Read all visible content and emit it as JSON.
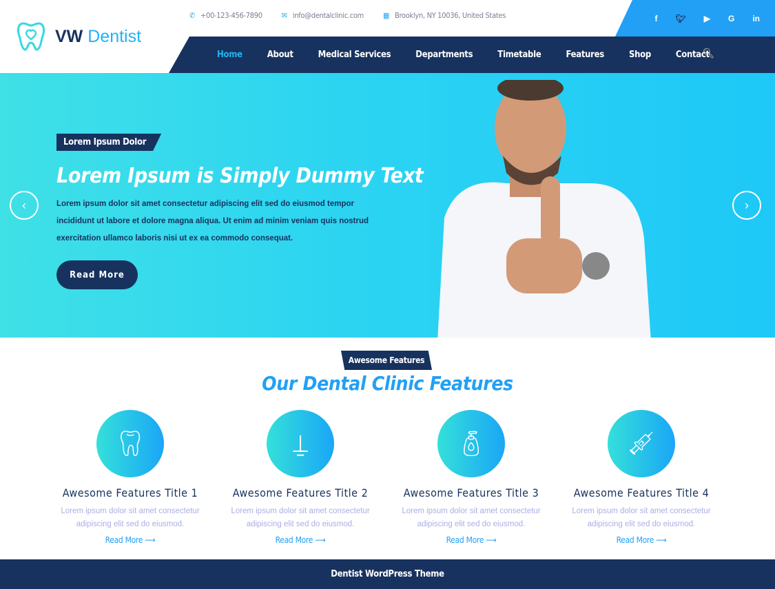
{
  "brand": {
    "name_bold": "VW",
    "name": "Dentist"
  },
  "topbar": {
    "phone": "+00-123-456-7890",
    "email": "info@dentalclinic.com",
    "address": "Brooklyn, NY 10036, United States"
  },
  "social": [
    "f",
    "t",
    "yt",
    "G",
    "in"
  ],
  "nav": [
    "Home",
    "About",
    "Medical Services",
    "Departments",
    "Timetable",
    "Features",
    "Shop",
    "Contact"
  ],
  "hero": {
    "tag": "Lorem Ipsum Dolor",
    "title": "Lorem Ipsum is Simply Dummy Text",
    "desc": "Lorem ipsum dolor sit amet consectetur adipiscing elit sed do eiusmod tempor incididunt ut labore et dolore magna aliqua. Ut enim ad minim veniam quis nostrud exercitation ullamco laboris nisi ut ex ea commodo consequat.",
    "button": "Read More"
  },
  "features": {
    "tag": "Awesome Features",
    "title": "Our Dental Clinic Features",
    "items": [
      {
        "title": "Awesome Features Title 1",
        "desc": "Lorem ipsum dolor sit amet consectetur adipiscing elit sed do eiusmod.",
        "link": "Read More ⟶",
        "icon": "tooth-icon"
      },
      {
        "title": "Awesome Features Title 2",
        "desc": "Lorem ipsum dolor sit amet consectetur adipiscing elit sed do eiusmod.",
        "link": "Read More ⟶",
        "icon": "implant-icon"
      },
      {
        "title": "Awesome Features Title 3",
        "desc": "Lorem ipsum dolor sit amet consectetur adipiscing elit sed do eiusmod.",
        "link": "Read More ⟶",
        "icon": "toothbrush-mouthwash-icon"
      },
      {
        "title": "Awesome Features Title 4",
        "desc": "Lorem ipsum dolor sit amet consectetur adipiscing elit sed do eiusmod.",
        "link": "Read More ⟶",
        "icon": "syringe-icon"
      }
    ]
  },
  "footer": {
    "text": "Dentist WordPress Theme"
  },
  "colors": {
    "navy": "#17325e",
    "accent": "#21a0f5",
    "cyan": "#3fe0e6"
  }
}
